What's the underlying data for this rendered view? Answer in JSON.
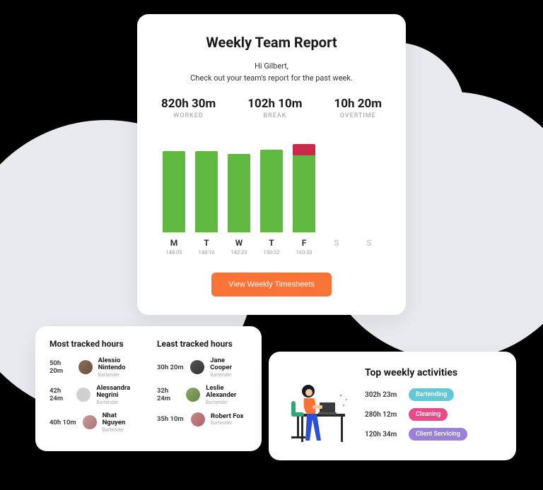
{
  "report": {
    "title": "Weekly Team Report",
    "greeting_line1": "Hi Gilbert,",
    "greeting_line2": "Check out your team's report for the past week.",
    "stats": {
      "worked": {
        "value": "820h 30m",
        "label": "WORKED"
      },
      "break": {
        "value": "102h 10m",
        "label": "BREAK"
      },
      "overtime": {
        "value": "10h 20m",
        "label": "OVERTIME"
      }
    },
    "cta": "View Weekly Timesheets"
  },
  "chart_data": {
    "type": "bar",
    "categories": [
      "M",
      "T",
      "W",
      "T",
      "F",
      "S",
      "S"
    ],
    "times": [
      "148:05",
      "148:10",
      "142:20",
      "150:32",
      "160:30",
      "",
      ""
    ],
    "values": [
      148.08,
      148.17,
      142.33,
      150.53,
      160.5,
      0,
      0
    ],
    "overtime": [
      0,
      0,
      0,
      0,
      20,
      0,
      0
    ],
    "ylim": [
      0,
      180
    ]
  },
  "tracked": {
    "most_title": "Most tracked hours",
    "least_title": "Least tracked hours",
    "most": [
      {
        "hours": "50h 20m",
        "name": "Alessio Nintendo",
        "role": "Bartender"
      },
      {
        "hours": "42h 24m",
        "name": "Alessandra Negrini",
        "role": "Bartender"
      },
      {
        "hours": "40h 10m",
        "name": "Nhat Nguyen",
        "role": "Bartender"
      }
    ],
    "least": [
      {
        "hours": "30h 20m",
        "name": "Jane Cooper",
        "role": "Bartender"
      },
      {
        "hours": "32h 24m",
        "name": "Leslie Alexander",
        "role": "Bartender"
      },
      {
        "hours": "35h 10m",
        "name": "Robert Fox",
        "role": "Bartender"
      }
    ]
  },
  "activities": {
    "title": "Top weekly activities",
    "items": [
      {
        "hours": "302h 23m",
        "label": "Bartending",
        "color": "teal"
      },
      {
        "hours": "280h 12m",
        "label": "Cleaning",
        "color": "pink"
      },
      {
        "hours": "120h 34m",
        "label": "Client Servicing",
        "color": "purple"
      }
    ]
  }
}
